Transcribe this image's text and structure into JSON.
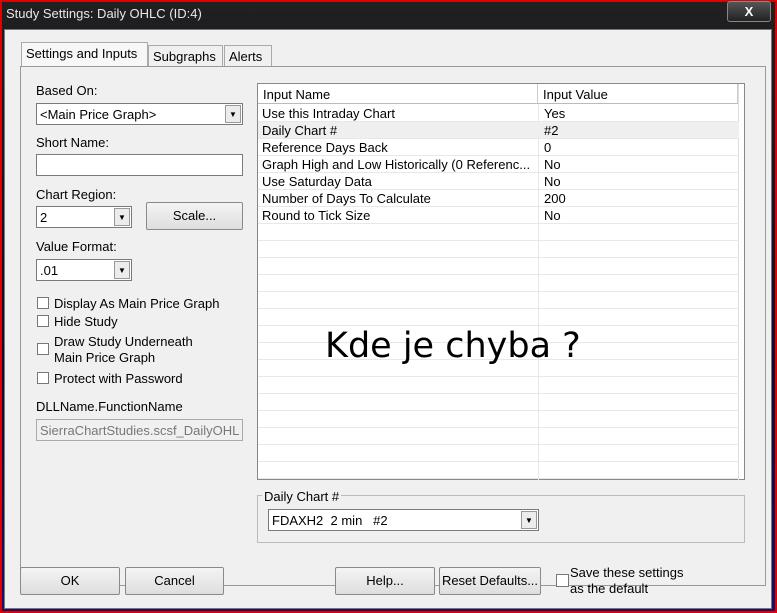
{
  "window": {
    "title": "Study Settings: Daily OHLC (ID:4)",
    "close_label": "X"
  },
  "tabs": [
    {
      "label": "Settings and Inputs",
      "active": true
    },
    {
      "label": "Subgraphs"
    },
    {
      "label": "Alerts"
    }
  ],
  "left": {
    "based_on_label": "Based On:",
    "based_on_value": "<Main Price Graph>",
    "short_name_label": "Short Name:",
    "short_name_value": "",
    "chart_region_label": "Chart Region:",
    "chart_region_value": "2",
    "scale_button": "Scale...",
    "value_format_label": "Value Format:",
    "value_format_value": ".01",
    "checkboxes": [
      {
        "label": "Display As Main Price Graph",
        "checked": false
      },
      {
        "label": "Hide Study",
        "checked": false
      },
      {
        "label": "Draw Study Underneath",
        "label2": "Main Price Graph",
        "checked": false
      },
      {
        "label": "Protect with Password",
        "checked": false
      }
    ],
    "dll_label": "DLLName.FunctionName",
    "dll_value": "SierraChartStudies.scsf_DailyOHL"
  },
  "grid": {
    "headers": [
      "Input Name",
      "Input Value"
    ],
    "rows": [
      {
        "name": "Use this Intraday Chart",
        "value": "Yes"
      },
      {
        "name": "Daily Chart #",
        "value": "#2"
      },
      {
        "name": "Reference Days Back",
        "value": "0"
      },
      {
        "name": "Graph High and Low Historically (0 Referenc...",
        "value": "No"
      },
      {
        "name": "Use Saturday Data",
        "value": "No"
      },
      {
        "name": "Number of Days To Calculate",
        "value": "200"
      },
      {
        "name": "Round to Tick Size",
        "value": "No"
      }
    ]
  },
  "annotation": "Kde je chyba ?",
  "group": {
    "label": "Daily Chart #",
    "value": "FDAXH2  2 min   #2"
  },
  "footer": {
    "ok": "OK",
    "cancel": "Cancel",
    "help": "Help...",
    "reset": "Reset Defaults...",
    "save_default_line1": "Save these settings",
    "save_default_line2": "as the default"
  }
}
